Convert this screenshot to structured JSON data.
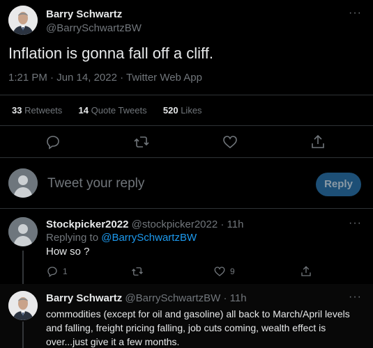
{
  "tweet": {
    "author_name": "Barry Schwartz",
    "author_handle": "@BarrySchwartzBW",
    "text": "Inflation is gonna fall off a cliff.",
    "meta": "1:21 PM · Jun 14, 2022 · Twitter Web App",
    "more_icon": "···",
    "stats": {
      "retweets_count": "33",
      "retweets_label": "Retweets",
      "quotes_count": "14",
      "quotes_label": "Quote Tweets",
      "likes_count": "520",
      "likes_label": "Likes"
    },
    "actions": [
      "reply-icon",
      "retweet-icon",
      "like-icon",
      "share-icon"
    ]
  },
  "composer": {
    "placeholder": "Tweet your reply",
    "button_label": "Reply"
  },
  "replies": [
    {
      "author_name": "Stockpicker2022",
      "author_handle": "@stockpicker2022",
      "time": "· 11h",
      "replying_prefix": "Replying to",
      "replying_to": "@BarrySchwartzBW",
      "text": "How so ?",
      "reply_count": "1",
      "retweet_count": "",
      "like_count": "9",
      "more_icon": "···"
    },
    {
      "author_name": "Barry Schwartz",
      "author_handle": "@BarrySchwartzBW",
      "time": "· 11h",
      "text": "commodities (except for oil and gasoline) all back to March/April levels and falling, freight pricing falling, job cuts coming, wealth effect is over...just give it a few months.",
      "more_icon": "···"
    }
  ],
  "colors": {
    "background": "#000000",
    "text": "#e7e9ea",
    "muted": "#71767b",
    "link": "#1d9bf0",
    "reply_button_bg": "#1d4f76"
  }
}
